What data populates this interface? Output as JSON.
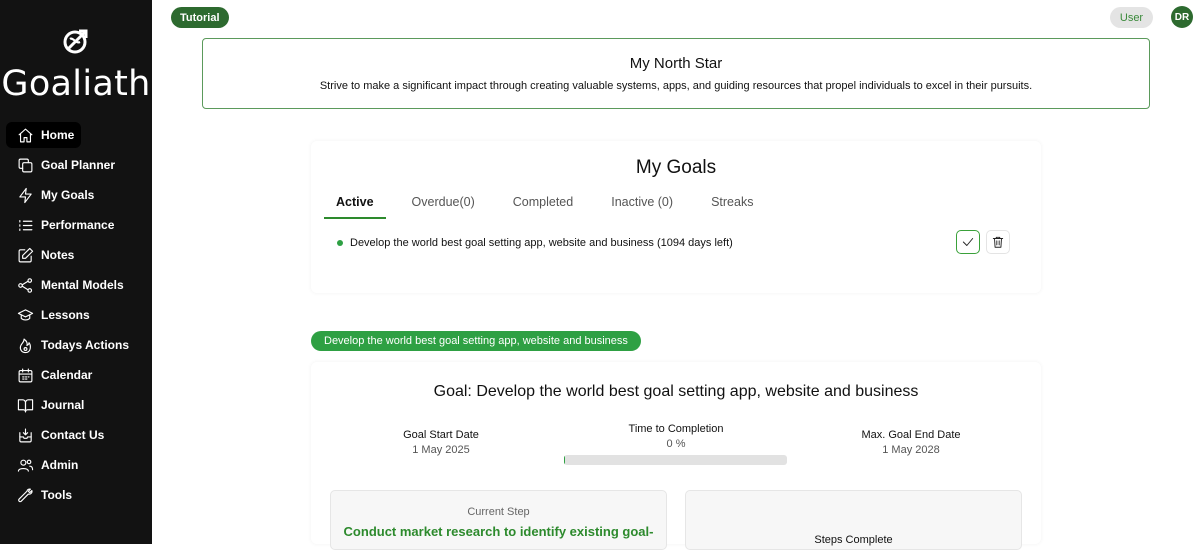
{
  "app": {
    "brand": "Goaliath",
    "logo_icon": "goaliath-logo-icon"
  },
  "sidebar": {
    "items": [
      {
        "label": "Home",
        "icon": "home-icon",
        "active": true
      },
      {
        "label": "Goal Planner",
        "icon": "copy-icon"
      },
      {
        "label": "My Goals",
        "icon": "bolt-icon"
      },
      {
        "label": "Performance",
        "icon": "list-icon"
      },
      {
        "label": "Notes",
        "icon": "edit-icon"
      },
      {
        "label": "Mental Models",
        "icon": "share-icon"
      },
      {
        "label": "Lessons",
        "icon": "graduation-cap-icon"
      },
      {
        "label": "Todays Actions",
        "icon": "fire-icon"
      },
      {
        "label": "Calendar",
        "icon": "calendar-icon"
      },
      {
        "label": "Journal",
        "icon": "book-icon"
      },
      {
        "label": "Contact Us",
        "icon": "inbox-icon"
      },
      {
        "label": "Admin",
        "icon": "users-icon"
      },
      {
        "label": "Tools",
        "icon": "wrench-icon"
      }
    ]
  },
  "header": {
    "tutorial_label": "Tutorial",
    "user_label": "User",
    "avatar_initials": "DR"
  },
  "north_star": {
    "title": "My North Star",
    "text": "Strive to make a significant impact through creating valuable systems, apps, and guiding resources that propel individuals to excel in their pursuits."
  },
  "goals": {
    "title": "My Goals",
    "tabs": [
      {
        "label": "Active",
        "active": true
      },
      {
        "label": "Overdue(0)"
      },
      {
        "label": "Completed"
      },
      {
        "label": "Inactive (0)"
      },
      {
        "label": "Streaks"
      }
    ],
    "items": [
      {
        "text": "Develop the world best goal setting app, website and business (1094 days left)"
      }
    ]
  },
  "selected_goal": {
    "pill_label": "Develop the world best goal setting app, website and business",
    "title": "Goal: Develop the world best goal setting app, website and business",
    "start_label": "Goal Start Date",
    "start_value": "1 May 2025",
    "completion_label": "Time to Completion",
    "completion_value": "0 %",
    "completion_fraction": 0.005,
    "end_label": "Max. Goal End Date",
    "end_value": "1 May 2028",
    "current_step_label": "Current Step",
    "current_step_text": "Conduct market research to identify existing goal-",
    "steps_complete_label": "Steps Complete"
  },
  "colors": {
    "sidebar_bg": "#121212",
    "accent_green": "#2ea043",
    "dark_green": "#2d6a2f"
  }
}
